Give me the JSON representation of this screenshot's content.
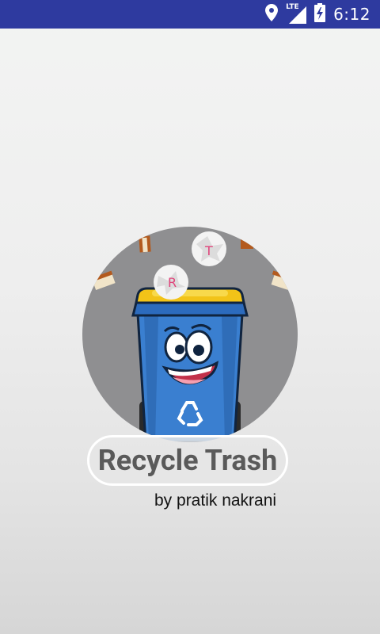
{
  "status_bar": {
    "time": "6:12",
    "network_label": "LTE",
    "icons": [
      "location-icon",
      "signal-icon",
      "battery-icon"
    ]
  },
  "app": {
    "title": "Recycle Trash",
    "byline": "by pratik nakrani",
    "logo": {
      "paper_ball_letters": [
        "R",
        "T"
      ],
      "bin_color": "#3a7fd0",
      "lid_color": "#f2c318",
      "background_color": "#8f8f91"
    }
  }
}
